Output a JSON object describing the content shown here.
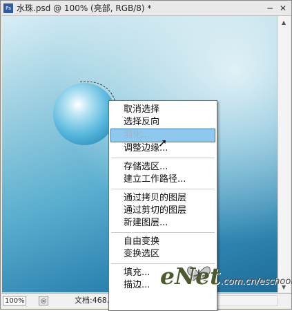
{
  "window": {
    "title": "水珠.psd @ 100% (亮部, RGB/8) *",
    "app_icon": "ps-icon",
    "buttons": [
      "minimize-icon",
      "close-icon"
    ]
  },
  "statusbar": {
    "zoom": "100%",
    "doc_info": "文档:468..."
  },
  "context_menu": {
    "groups": [
      [
        "取消选择",
        "选择反向",
        "羽化...",
        "调整边缘..."
      ],
      [
        "存储选区...",
        "建立工作路径..."
      ],
      [
        "通过拷贝的图层",
        "通过剪切的图层",
        "新建图层..."
      ],
      [
        "自由变换",
        "变换选区"
      ],
      [
        "填充...",
        "描边..."
      ]
    ],
    "highlighted": "羽化..."
  },
  "watermark": {
    "main": "eNet",
    "suffix": ".com.cn/eschool"
  },
  "colors": {
    "menu_highlight": "#8fc8ee",
    "canvas_gradient_start": "#d9eef6",
    "canvas_gradient_end": "#1e6c98"
  }
}
